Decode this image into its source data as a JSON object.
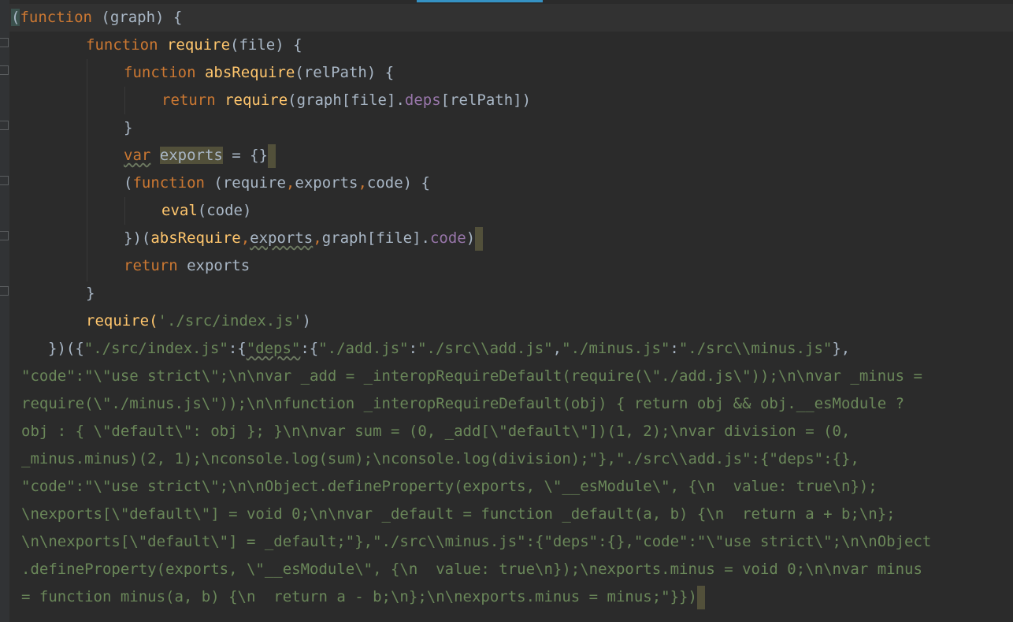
{
  "colors": {
    "background": "#2b2b2b",
    "keyword": "#cc7832",
    "function": "#ffc66d",
    "property": "#9876aa",
    "string": "#6a8759",
    "text": "#a9b7c6",
    "tab_accent": "#3592c4"
  },
  "code": {
    "l1": [
      "(",
      "function",
      " (graph) {"
    ],
    "l2": [
      "function",
      " ",
      "require",
      "(file) {"
    ],
    "l3": [
      "function",
      " ",
      "absRequire",
      "(relPath) {"
    ],
    "l4": [
      "return",
      " ",
      "require",
      "(graph[file].",
      "deps",
      "[relPath])"
    ],
    "l5": [
      "}"
    ],
    "l6": [
      "var",
      " ",
      "exports",
      " = {}"
    ],
    "l7": [
      "(",
      "function",
      " (require",
      ",",
      "exports",
      ",",
      "code) {"
    ],
    "l8": [
      "eval",
      "(code)"
    ],
    "l9": [
      "})(",
      "absRequire",
      ",",
      "exports",
      ",",
      "graph[file].",
      "code",
      ")"
    ],
    "l10": [
      "return",
      " exports"
    ],
    "l11": [
      "}"
    ],
    "l12": [
      "require(",
      "'./src/index.js'",
      ")"
    ],
    "l13": [
      "})",
      "({",
      "\"./src/index.js\"",
      ":{",
      "\"deps\"",
      ":{",
      "\"./add.js\"",
      ":",
      "\"./src\\\\add.js\"",
      ",",
      "\"./minus.js\"",
      ":",
      "\"./src\\\\minus.js\"",
      "},"
    ],
    "l14": [
      "\"code\":\"\\\"use strict\\\";\\n\\nvar _add = _interopRequireDefault(require(\\\"./add.js\\\"));\\n\\nvar _minus ="
    ],
    "l15": [
      "require(\\\"./minus.js\\\"));\\n\\nfunction _interopRequireDefault(obj) { return obj && obj.__esModule ?"
    ],
    "l16": [
      "obj : { \\\"default\\\": obj }; }\\n\\nvar sum = (0, _add[\\\"default\\\"])(1, 2);\\nvar division = (0,"
    ],
    "l17": [
      "_minus.minus)(2, 1);\\nconsole.log(sum);\\nconsole.log(division);\"},\"./src\\\\add.js\":{\"deps\":{},"
    ],
    "l18": [
      "\"code\":\"\\\"use strict\\\";\\n\\nObject.defineProperty(exports, \\\"__esModule\\\", {\\n  value: true\\n});"
    ],
    "l19": [
      "\\nexports[\\\"default\\\"] = void 0;\\n\\nvar _default = function _default(a, b) {\\n  return a + b;\\n};"
    ],
    "l20": [
      "\\n\\nexports[\\\"default\\\"] = _default;\"},\"./src\\\\minus.js\":{\"deps\":{},\"code\":\"\\\"use strict\\\";\\n\\nObject"
    ],
    "l21": [
      ".defineProperty(exports, \\\"__esModule\\\", {\\n  value: true\\n});\\nexports.minus = void 0;\\n\\nvar minus"
    ],
    "l22": [
      "= function minus(a, b) {\\n  return a - b;\\n};\\n\\nexports.minus = minus;\"}})"
    ]
  }
}
